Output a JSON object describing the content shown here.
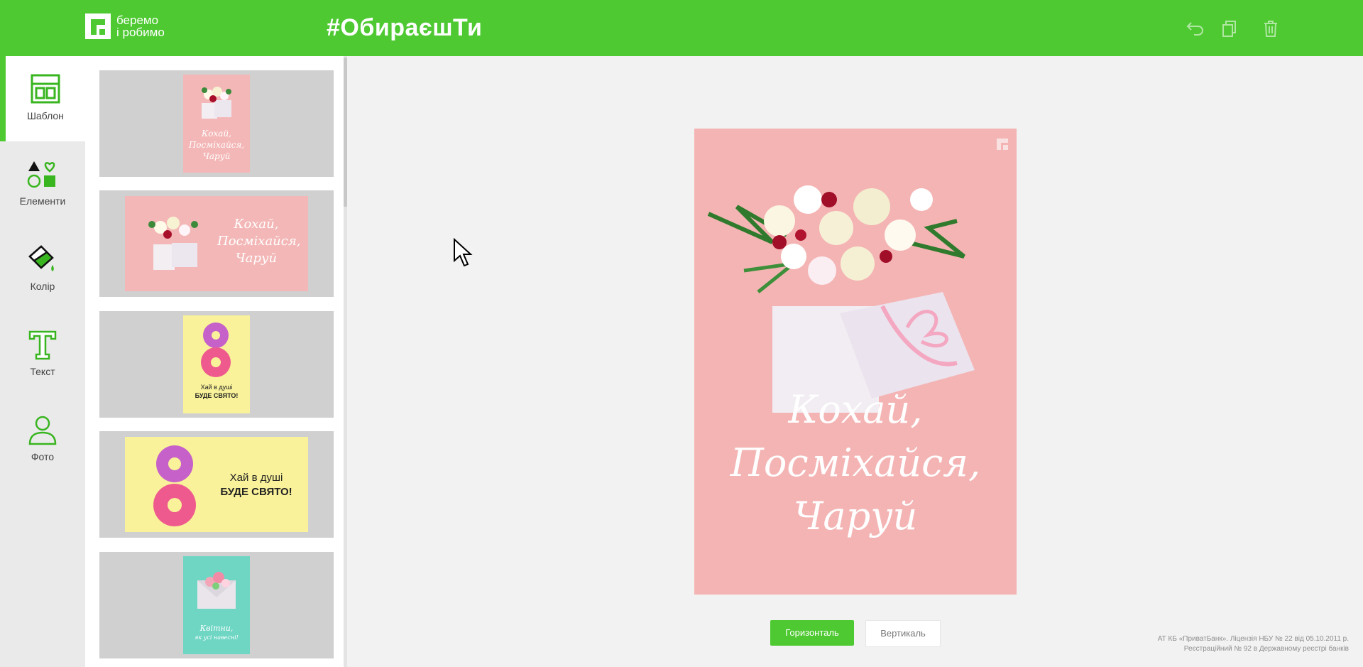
{
  "header": {
    "logo_line1": "беремо",
    "logo_line2": "і робимо",
    "hashtag": "#ОбираєшТи"
  },
  "tools": [
    {
      "label": "Шаблон",
      "icon": "template-icon"
    },
    {
      "label": "Елементи",
      "icon": "shapes-icon"
    },
    {
      "label": "Колір",
      "icon": "paint-bucket-icon"
    },
    {
      "label": "Текст",
      "icon": "text-icon"
    },
    {
      "label": "Фото",
      "icon": "user-photo-icon"
    }
  ],
  "templates": {
    "t1_text": "Кохай, Посміхайся, Чаруй",
    "t2_text_l1": "Кохай,",
    "t2_text_l2": "Посміхайся,",
    "t2_text_l3": "Чаруй",
    "t3_text_l1": "Хай в душі",
    "t3_text_l2": "БУДЕ СВЯТО!",
    "t4_text_l1": "Хай в душі",
    "t4_text_l2": "БУДЕ СВЯТО!",
    "t5_text_l1": "Квітни,",
    "t5_text_l2": "як усі навесні!"
  },
  "canvas": {
    "line1": "Кохай,",
    "line2": "Посміхайся,",
    "line3": "Чаруй"
  },
  "orientation": {
    "horizontal": "Горизонталь",
    "vertical": "Вертикаль"
  },
  "footer": {
    "line1": "АТ КБ «ПриватБанк». Ліцензія НБУ № 22 від 05.10.2011 р.",
    "line2": "Реєстраційний № 92 в Державному реєстрі банків"
  },
  "colors": {
    "brand_green": "#4ec932",
    "card_pink": "#f4b4b4"
  }
}
